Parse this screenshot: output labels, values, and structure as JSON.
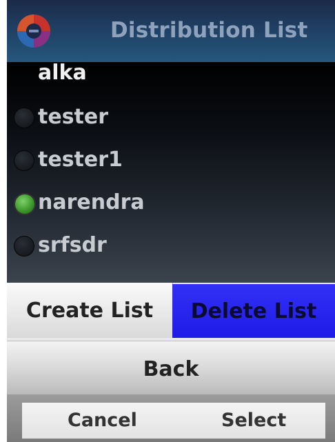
{
  "header": {
    "title": "Distribution List",
    "logo_icon": "app-logo-icon"
  },
  "list": {
    "items": [
      {
        "label": "alka",
        "selected": false
      },
      {
        "label": "tester",
        "selected": false
      },
      {
        "label": "tester1",
        "selected": false
      },
      {
        "label": "narendra",
        "selected": true
      },
      {
        "label": "srfsdr",
        "selected": false
      }
    ]
  },
  "menu": {
    "create_label": "Create List",
    "delete_label": "Delete List",
    "back_label": "Back"
  },
  "softkeys": {
    "left": "Cancel",
    "right": "Select"
  },
  "colors": {
    "header_bg": "#1f3f63",
    "highlight": "#2522ee",
    "radio_selected": "#3e9a2d"
  }
}
